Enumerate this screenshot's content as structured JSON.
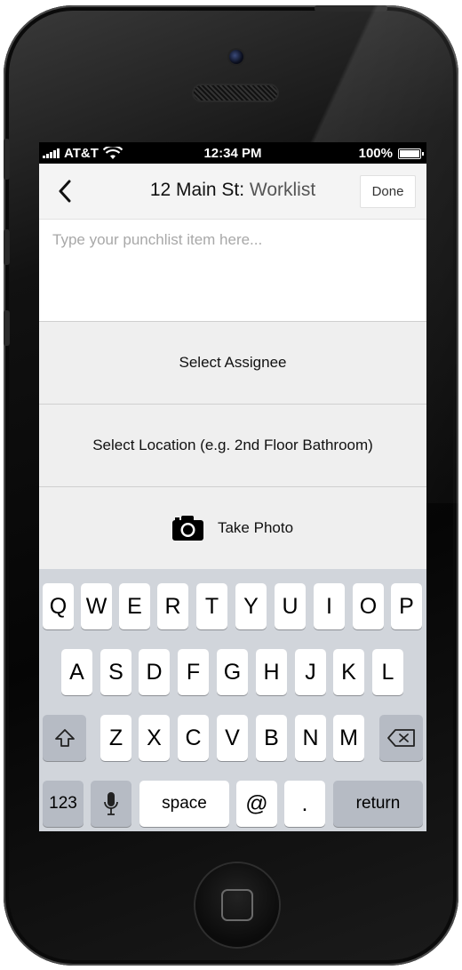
{
  "status_bar": {
    "carrier": "AT&T",
    "time": "12:34 PM",
    "battery": "100%"
  },
  "nav": {
    "title_main": "12 Main St: ",
    "title_sub": "Worklist",
    "done_label": "Done",
    "back_icon": "chevron-left-icon"
  },
  "punch_input": {
    "placeholder": "Type your punchlist item here...",
    "value": ""
  },
  "rows": {
    "assignee": "Select Assignee",
    "location": "Select Location (e.g. 2nd Floor Bathroom)",
    "photo": "Take Photo",
    "photo_icon": "camera-icon"
  },
  "keyboard": {
    "row1": [
      "Q",
      "W",
      "E",
      "R",
      "T",
      "Y",
      "U",
      "I",
      "O",
      "P"
    ],
    "row2": [
      "A",
      "S",
      "D",
      "F",
      "G",
      "H",
      "J",
      "K",
      "L"
    ],
    "row3": [
      "Z",
      "X",
      "C",
      "V",
      "B",
      "N",
      "M"
    ],
    "numbers": "123",
    "space": "space",
    "at": "@",
    "dot": ".",
    "return": "return",
    "shift_icon": "shift-icon",
    "backspace_icon": "backspace-icon",
    "mic_icon": "microphone-icon"
  }
}
